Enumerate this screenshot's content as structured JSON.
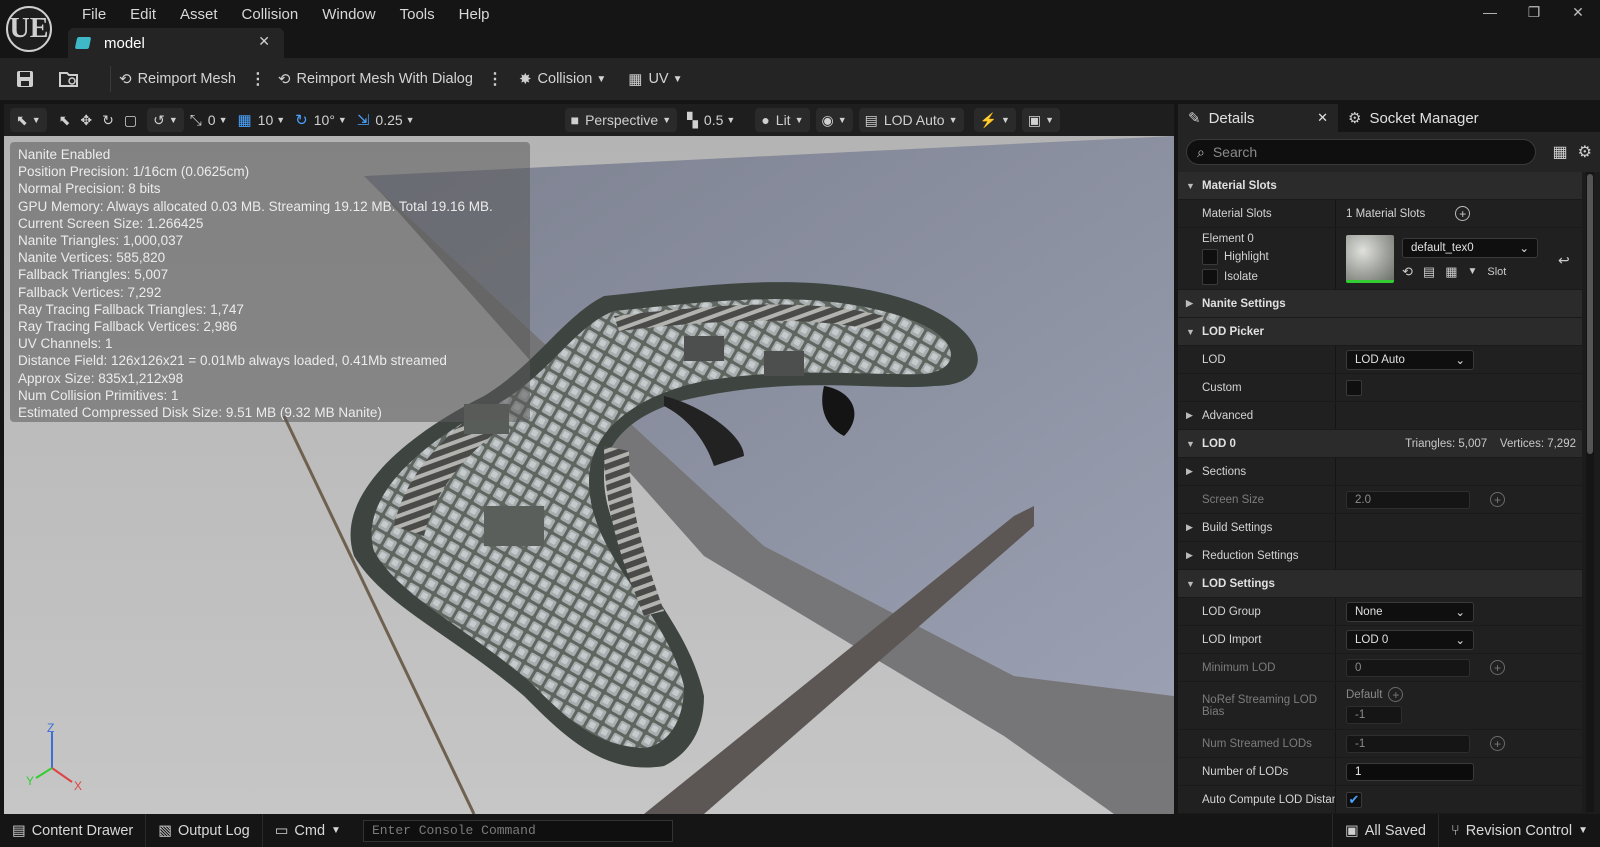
{
  "app": {
    "logo": "UE",
    "menu": [
      "File",
      "Edit",
      "Asset",
      "Collision",
      "Window",
      "Tools",
      "Help"
    ],
    "tab_title": "model"
  },
  "toolbar": {
    "reimport": "Reimport Mesh",
    "reimport_dialog": "Reimport Mesh With Dialog",
    "collision": "Collision",
    "uv": "UV"
  },
  "viewport_toolbar": {
    "rotate_snap": "0",
    "grid_snap": "10",
    "angle_snap": "10°",
    "scale_snap": "0.25",
    "view_mode": "Perspective",
    "camera_speed": "0.5",
    "lighting": "Lit",
    "lod": "LOD Auto"
  },
  "stats": [
    "Nanite Enabled",
    "Position Precision: 1/16cm (0.0625cm)",
    "Normal Precision: 8 bits",
    "GPU Memory: Always allocated 0.03 MB. Streaming 19.12 MB. Total 19.16 MB.",
    "Current Screen Size: 1.266425",
    "Nanite Triangles: 1,000,037",
    "Nanite Vertices: 585,820",
    "Fallback Triangles: 5,007",
    "Fallback Vertices: 7,292",
    "Ray Tracing Fallback Triangles: 1,747",
    "Ray Tracing Fallback Vertices: 2,986",
    "UV Channels: 1",
    "Distance Field: 126x126x21 = 0.01Mb always loaded, 0.41Mb streamed",
    "Approx Size: 835x1,212x98",
    "Num Collision Primitives: 1",
    "Estimated Compressed Disk Size: 9.51 MB (9.32 MB Nanite)"
  ],
  "axis": {
    "z": "Z",
    "y": "Y",
    "x": "X"
  },
  "details": {
    "tab_details": "Details",
    "tab_socket": "Socket Manager",
    "search_placeholder": "Search",
    "material_slots_cat": "Material Slots",
    "material_slots_label": "Material Slots",
    "material_slots_value": "1 Material Slots",
    "element0": "Element 0",
    "highlight": "Highlight",
    "isolate": "Isolate",
    "material_name": "default_tex0",
    "slot": "Slot",
    "nanite_settings": "Nanite Settings",
    "lod_picker": "LOD Picker",
    "lod_label": "LOD",
    "lod_value": "LOD Auto",
    "custom": "Custom",
    "advanced": "Advanced",
    "lod0": "LOD 0",
    "lod0_stats": "Triangles: 5,007    Vertices: 7,292",
    "sections": "Sections",
    "screen_size": "Screen Size",
    "screen_size_value": "2.0",
    "build_settings": "Build Settings",
    "reduction_settings": "Reduction Settings",
    "lod_settings": "LOD Settings",
    "lod_group": "LOD Group",
    "lod_group_value": "None",
    "lod_import": "LOD Import",
    "lod_import_value": "LOD 0",
    "minimum_lod": "Minimum LOD",
    "minimum_lod_value": "0",
    "noref_bias": "NoRef Streaming LOD Bias",
    "noref_default": "Default",
    "noref_value": "-1",
    "num_streamed": "Num Streamed LODs",
    "num_streamed_value": "-1",
    "number_of_lods": "Number of LODs",
    "number_of_lods_value": "1",
    "auto_compute": "Auto Compute LOD Distances"
  },
  "status": {
    "content_drawer": "Content Drawer",
    "output_log": "Output Log",
    "cmd": "Cmd",
    "console_placeholder": "Enter Console Command",
    "all_saved": "All Saved",
    "revision_control": "Revision Control"
  }
}
